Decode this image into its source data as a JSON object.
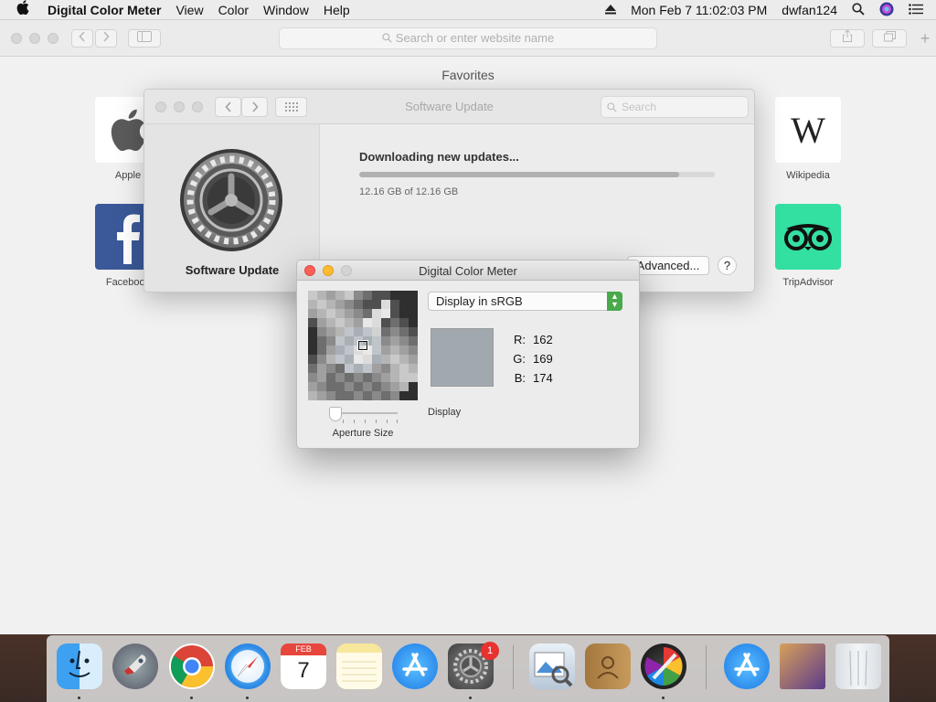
{
  "menubar": {
    "app_name": "Digital Color Meter",
    "menus": [
      "View",
      "Color",
      "Window",
      "Help"
    ],
    "datetime": "Mon Feb 7  11:02:03 PM",
    "user": "dwfan124"
  },
  "safari": {
    "address_placeholder": "Search or enter website name",
    "favorites_title": "Favorites",
    "favorites": [
      {
        "label": "Apple"
      },
      {
        "label": "Facebook"
      },
      {
        "label": "Wikipedia",
        "glyph": "W"
      },
      {
        "label": "TripAdvisor"
      }
    ]
  },
  "software_update": {
    "title": "Software Update",
    "search_placeholder": "Search",
    "pane_name": "Software Update",
    "status": "Downloading new updates...",
    "progress": 0.9,
    "size_text": "12.16 GB of 12.16 GB",
    "advanced_button": "Advanced...",
    "help_button": "?"
  },
  "color_meter": {
    "title": "Digital Color Meter",
    "mode": "Display in sRGB",
    "swatch_color": "#a2a9ae",
    "r_label": "R:",
    "r_value": "162",
    "g_label": "G:",
    "g_value": "169",
    "b_label": "B:",
    "b_value": "174",
    "aperture_label": "Aperture Size",
    "display_label": "Display"
  },
  "dock": {
    "items": [
      "Finder",
      "Launchpad",
      "Google Chrome",
      "Safari",
      "Calendar",
      "Notes",
      "App Store",
      "System Preferences",
      "Preview",
      "Contacts",
      "Digital Color Meter",
      "App Store Downloads",
      "Photos",
      "Trash"
    ],
    "calendar_month": "FEB",
    "calendar_day": "7",
    "badge_count": "1"
  }
}
